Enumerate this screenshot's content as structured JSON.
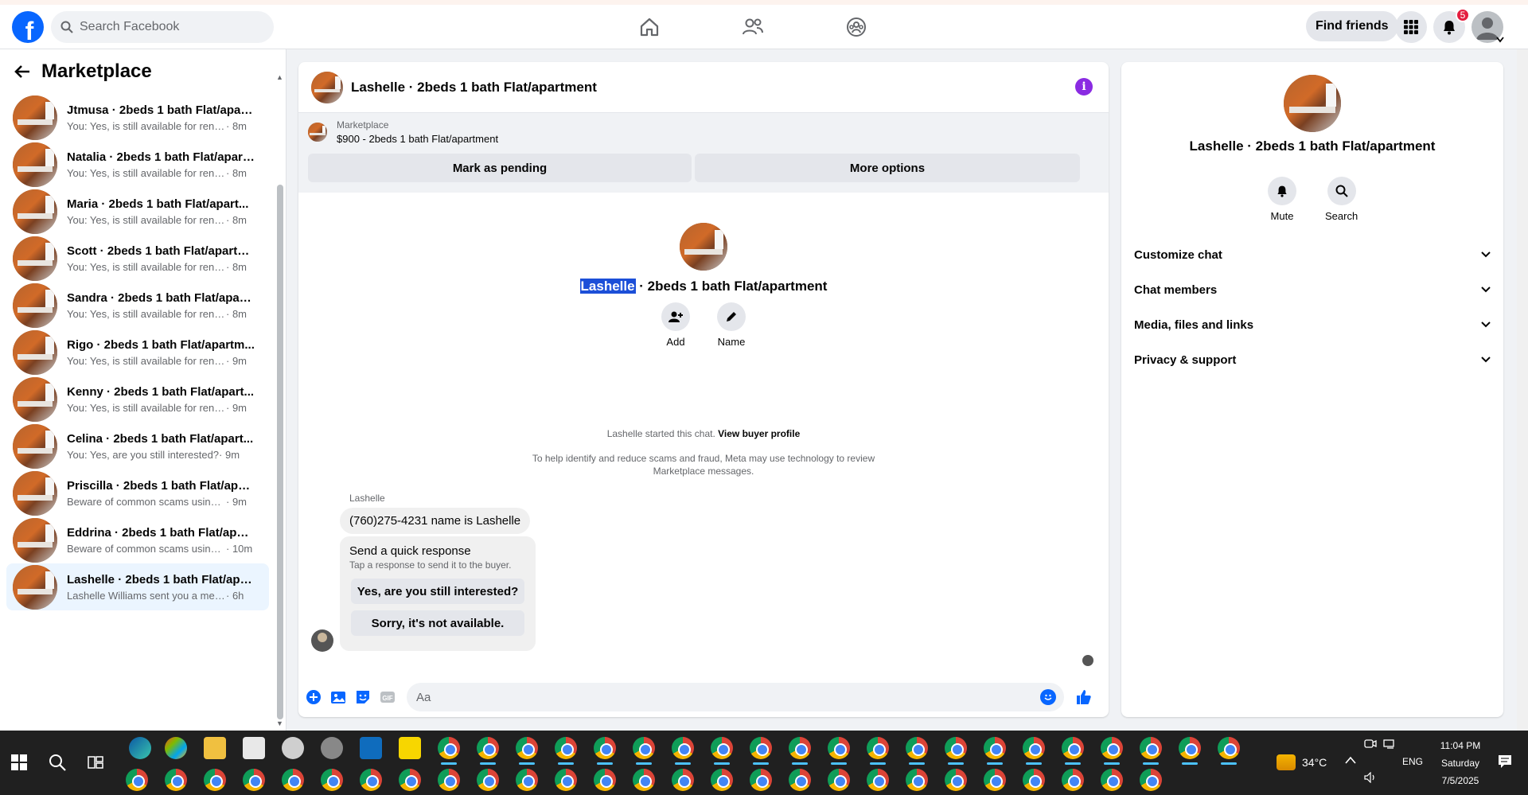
{
  "topbar": {
    "logo": "f",
    "search_placeholder": "Search Facebook",
    "find_friends": "Find friends",
    "notifications_count": "5"
  },
  "marketplace": {
    "title": "Marketplace",
    "conversations": [
      {
        "title": "Jtmusa · 2beds 1 bath Flat/apart...",
        "msg": "You: Yes, is still available for rent. P...",
        "time": "· 8m"
      },
      {
        "title": "Natalia · 2beds 1 bath Flat/apart...",
        "msg": "You: Yes, is still available for rent. P...",
        "time": "· 8m"
      },
      {
        "title": "Maria · 2beds 1 bath Flat/apart...",
        "msg": "You: Yes, is still available for rent. P...",
        "time": "· 8m"
      },
      {
        "title": "Scott · 2beds 1 bath Flat/apartm...",
        "msg": "You: Yes, is still available for rent. P...",
        "time": "· 8m"
      },
      {
        "title": "Sandra · 2beds 1 bath Flat/apart...",
        "msg": "You: Yes, is still available for rent. P...",
        "time": "· 8m"
      },
      {
        "title": "Rigo · 2beds 1 bath Flat/apartm...",
        "msg": "You: Yes, is still available for rent. P...",
        "time": "· 9m"
      },
      {
        "title": "Kenny · 2beds 1 bath Flat/apart...",
        "msg": "You: Yes, is still available for rent. P...",
        "time": "· 9m"
      },
      {
        "title": "Celina · 2beds 1 bath Flat/apart...",
        "msg": "You: Yes, are you still interested?",
        "time": "· 9m"
      },
      {
        "title": "Priscilla · 2beds 1 bath Flat/apart...",
        "msg": "Beware of common scams using p...",
        "time": "· 9m"
      },
      {
        "title": "Eddrina · 2beds 1 bath Flat/apart...",
        "msg": "Beware of common scams using ...",
        "time": "· 10m"
      },
      {
        "title": "Lashelle · 2beds 1 bath Flat/apar...",
        "msg": "Lashelle Williams sent you a messa...",
        "time": "· 6h"
      }
    ]
  },
  "chat": {
    "title": "Lashelle · 2beds 1 bath Flat/apartment",
    "listing_source": "Marketplace",
    "listing_desc": "$900 - 2beds 1 bath Flat/apartment",
    "mark_pending": "Mark as pending",
    "more_options": "More options",
    "intro_name_highlight": "Lashelle",
    "intro_name_rest": " · 2beds 1 bath Flat/apartment",
    "add_label": "Add",
    "name_label": "Name",
    "started_text": "Lashelle started this chat.",
    "view_buyer": "View buyer profile",
    "scam_notice": "To help identify and reduce scams and fraud, Meta may use technology to review Marketplace messages.",
    "sender": "Lashelle",
    "message": "(760)275-4231 name is Lashelle",
    "quick_title": "Send a quick response",
    "quick_sub": "Tap a response to send it to the buyer.",
    "quick_1": "Yes, are you still interested?",
    "quick_2": "Sorry, it's not available.",
    "composer_placeholder": "Aa"
  },
  "details": {
    "title": "Lashelle · 2beds 1 bath Flat/apartment",
    "mute": "Mute",
    "search": "Search",
    "sections": [
      "Customize chat",
      "Chat members",
      "Media, files and links",
      "Privacy & support"
    ]
  },
  "taskbar": {
    "temperature": "34°C",
    "lang": "ENG",
    "time": "11:04 PM",
    "day": "Saturday",
    "date": "7/5/2025"
  },
  "colors": {
    "brand": "#0866ff",
    "info": "#8a2be2",
    "highlight": "#1c4fd8"
  }
}
